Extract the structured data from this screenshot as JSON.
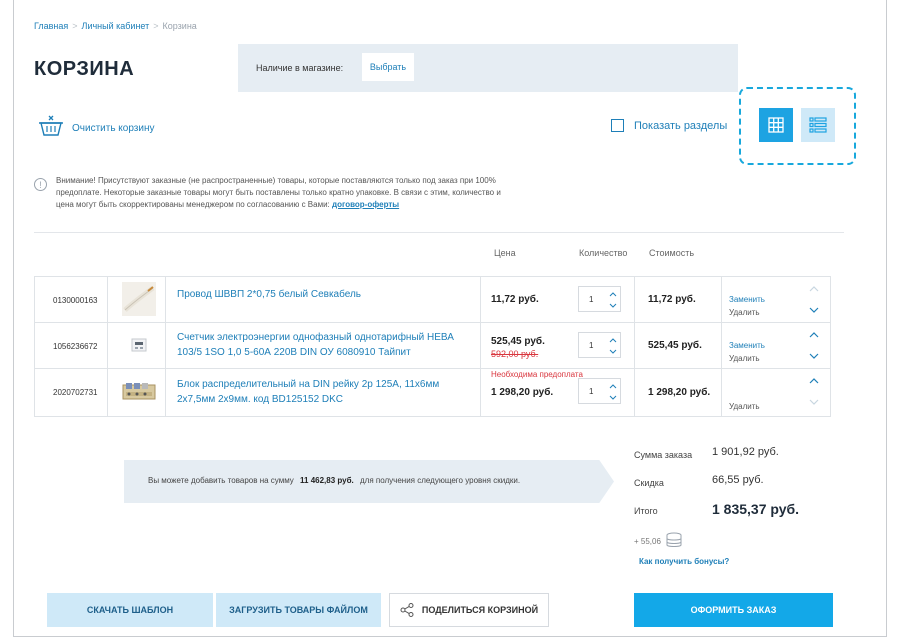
{
  "breadcrumb": {
    "home": "Главная",
    "account": "Личный кабинет",
    "current": "Корзина"
  },
  "page_title": "КОРЗИНА",
  "store": {
    "label": "Наличие в магазине:",
    "button": "Выбрать"
  },
  "clear_cart": "Очистить корзину",
  "show_sections": "Показать разделы",
  "notice": {
    "text": "Внимание! Присутствуют заказные (не распространенные) товары, которые поставляются только под заказ при 100% предоплате. Некоторые заказные товары могут быть поставлены только кратно упаковке. В связи с этим, количество и цена могут быть скорректированы менеджером по согласованию с Вами:",
    "link": "договор-оферты"
  },
  "columns": {
    "price": "Цена",
    "quantity": "Количество",
    "cost": "Стоимость"
  },
  "items": [
    {
      "code": "0130000163",
      "name": "Провод ШВВП 2*0,75 белый Севкабель",
      "price": "11,72 руб.",
      "old_price": "",
      "note": "",
      "qty": "1",
      "total": "11,72 руб.",
      "replace": "Заменить",
      "delete": "Удалить",
      "thumb_icon": "wire-icon"
    },
    {
      "code": "1056236672",
      "name": "Счетчик электроэнергии однофазный однотарифный НЕВА 103/5 1SO 1,0 5-60А 220В DIN ОУ 6080910 Тайпит",
      "price": "525,45 руб.",
      "old_price": "592,00 руб.",
      "note": "",
      "qty": "1",
      "total": "525,45 руб.",
      "replace": "Заменить",
      "delete": "Удалить",
      "thumb_icon": "meter-icon"
    },
    {
      "code": "2020702731",
      "name": "Блок распределительный на DIN рейку 2р 125А, 11х6мм 2х7,5мм 2х9мм. код BD125152 DKC",
      "price": "1 298,20 руб.",
      "old_price": "",
      "note": "Необходима предоплата",
      "qty": "1",
      "total": "1 298,20 руб.",
      "replace": "",
      "delete": "Удалить",
      "thumb_icon": "terminal-block-icon"
    }
  ],
  "discount": {
    "prefix": "Вы можете добавить товаров на сумму",
    "amount": "11 462,83 руб.",
    "suffix": "для получения следующего уровня скидки."
  },
  "summary": {
    "sum_label": "Сумма заказа",
    "sum_value": "1 901,92 руб.",
    "discount_label": "Скидка",
    "discount_value": "66,55 руб.",
    "total_label": "Итого",
    "total_value": "1 835,37 руб.",
    "bonus": "+ 55,06",
    "bonus_link": "Как получить бонусы?"
  },
  "buttons": {
    "download": "СКАЧАТЬ ШАБЛОН",
    "upload": "ЗАГРУЗИТЬ ТОВАРЫ ФАЙЛОМ",
    "share": "ПОДЕЛИТЬСЯ КОРЗИНОЙ",
    "checkout": "ОФОРМИТЬ ЗАКАЗ"
  },
  "colors": {
    "accent": "#13a8e8",
    "link": "#1e7fb8",
    "alert": "#d9363e",
    "panel": "#e6edf3"
  }
}
